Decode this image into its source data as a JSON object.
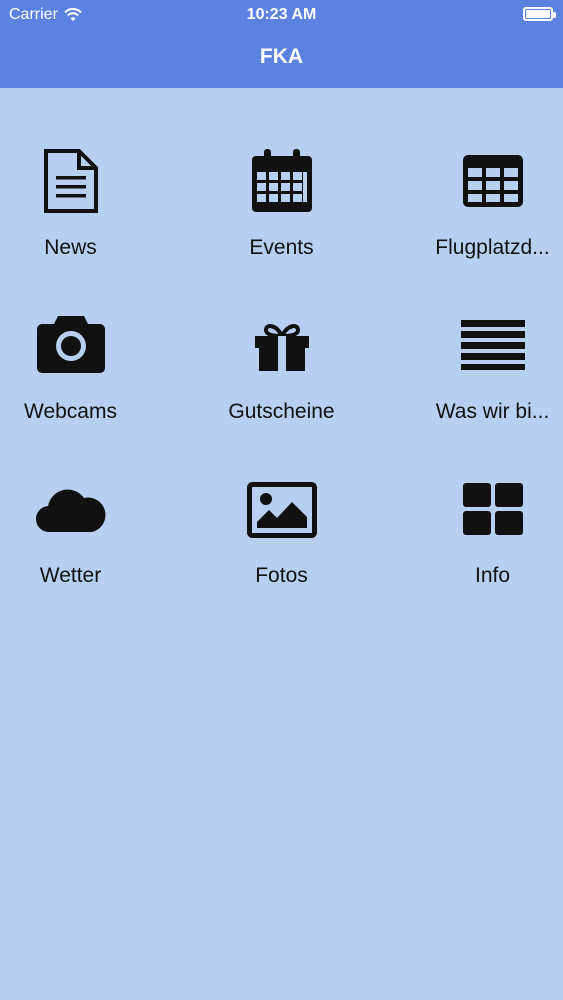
{
  "status_bar": {
    "carrier": "Carrier",
    "time": "10:23 AM"
  },
  "header": {
    "title": "FKA"
  },
  "tiles": [
    {
      "label": "News",
      "icon": "document-icon"
    },
    {
      "label": "Events",
      "icon": "calendar-icon"
    },
    {
      "label": "Flugplatzd...",
      "icon": "table-icon"
    },
    {
      "label": "Webcams",
      "icon": "camera-icon"
    },
    {
      "label": "Gutscheine",
      "icon": "gift-icon"
    },
    {
      "label": "Was wir bi...",
      "icon": "list-icon"
    },
    {
      "label": "Wetter",
      "icon": "cloud-icon"
    },
    {
      "label": "Fotos",
      "icon": "image-icon"
    },
    {
      "label": "Info",
      "icon": "grid-icon"
    }
  ],
  "colors": {
    "header_bg": "#5b82e0",
    "page_bg": "#b7cff1",
    "icon": "#111111"
  }
}
